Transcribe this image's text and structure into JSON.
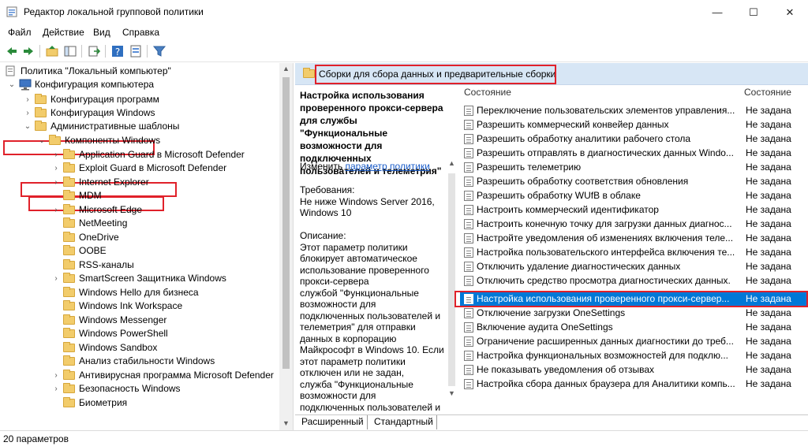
{
  "window": {
    "title": "Редактор локальной групповой политики",
    "minimize": "—",
    "maximize": "☐",
    "close": "✕"
  },
  "menu": [
    "Файл",
    "Действие",
    "Вид",
    "Справка"
  ],
  "toolbar_icons": [
    "back-icon",
    "forward-icon",
    "up-folder-icon",
    "show-hide-tree-icon",
    "export-list-icon",
    "help-icon",
    "properties-icon",
    "filter-icon"
  ],
  "tree": {
    "root": "Политика \"Локальный компьютер\"",
    "computer_config": "Конфигурация компьютера",
    "program_config": "Конфигурация программ",
    "windows_config": "Конфигурация Windows",
    "admin_templates": "Административные шаблоны",
    "windows_components": "Компоненты Windows",
    "items": [
      "Application Guard в Microsoft Defender",
      "Exploit Guard в Microsoft Defender",
      "Internet Explorer",
      "MDM",
      "Microsoft Edge",
      "NetMeeting",
      "OneDrive",
      "OOBE",
      "RSS-каналы",
      "SmartScreen Защитника Windows",
      "Windows Hello для бизнеса",
      "Windows Ink Workspace",
      "Windows Messenger",
      "Windows PowerShell",
      "Windows Sandbox",
      "Анализ стабильности Windows",
      "Антивирусная программа Microsoft Defender",
      "Безопасность Windows",
      "Биометрия"
    ]
  },
  "right_header": "Сборки для сбора данных и предварительные сборки",
  "description": {
    "title_lines": [
      "Настройка использования",
      "проверенного прокси-сервера",
      "для службы \"Функциональные",
      "возможности для подключенных",
      "пользователей и телеметрия\""
    ],
    "edit_prefix": "Изменить",
    "edit_link": "параметр политики",
    "requirements_label": "Требования:",
    "requirements_lines": [
      "Не ниже Windows Server 2016,",
      "Windows 10"
    ],
    "description_label": "Описание:",
    "description_lines": [
      "Этот параметр политики",
      "блокирует автоматическое",
      "использование проверенного",
      "прокси-сервера",
      "службой \"Функциональные",
      "возможности для",
      "подключенных пользователей и",
      "телеметрия\" для отправки",
      "данных в корпорацию",
      "Майкрософт в Windows 10. Если",
      "этот параметр политики",
      "отключен или не задан,",
      "служба \"Функциональные",
      "возможности для",
      "подключенных пользователей и"
    ]
  },
  "list": {
    "col_name": "Состояние",
    "col_state": "Состояние",
    "rows": [
      {
        "name": "Переключение пользовательских элементов управления...",
        "state": "Не задана"
      },
      {
        "name": "Разрешить коммерческий конвейер данных",
        "state": "Не задана"
      },
      {
        "name": "Разрешить обработку аналитики рабочего стола",
        "state": "Не задана"
      },
      {
        "name": "Разрешить отправлять в диагностических данных Windo...",
        "state": "Не задана"
      },
      {
        "name": "Разрешить телеметрию",
        "state": "Не задана"
      },
      {
        "name": "Разрешить обработку соответствия обновления",
        "state": "Не задана"
      },
      {
        "name": "Разрешить обработку WUfB в облаке",
        "state": "Не задана"
      },
      {
        "name": "Настроить коммерческий идентификатор",
        "state": "Не задана"
      },
      {
        "name": "Настроить конечную точку для загрузки данных диагнос...",
        "state": "Не задана"
      },
      {
        "name": "Настройте уведомления об изменениях включения теле...",
        "state": "Не задана"
      },
      {
        "name": "Настройка пользовательского интерфейса включения те...",
        "state": "Не задана"
      },
      {
        "name": "Отключить удаление диагностических данных",
        "state": "Не задана"
      },
      {
        "name": "Отключить средство просмотра диагностических данных.",
        "state": "Не задана"
      },
      {
        "name": "Настройка использования проверенного прокси-сервер...",
        "state": "Не задана"
      },
      {
        "name": "Отключение загрузки OneSettings",
        "state": "Не задана"
      },
      {
        "name": "Включение аудита OneSettings",
        "state": "Не задана"
      },
      {
        "name": "Ограничение расширенных данных диагностики до треб...",
        "state": "Не задана"
      },
      {
        "name": "Настройка функциональных возможностей для подклю...",
        "state": "Не задана"
      },
      {
        "name": "Не показывать уведомления об отзывах",
        "state": "Не задана"
      },
      {
        "name": "Настройка сбора данных браузера для Аналитики компь...",
        "state": "Не задана"
      }
    ],
    "selected_index": 13
  },
  "tabs": [
    "Расширенный",
    "Стандартный"
  ],
  "status": "20 параметров",
  "colors": {
    "selection": "#0078d7",
    "highlight_box": "#e0212a",
    "header_bg": "#d7e6f5"
  }
}
